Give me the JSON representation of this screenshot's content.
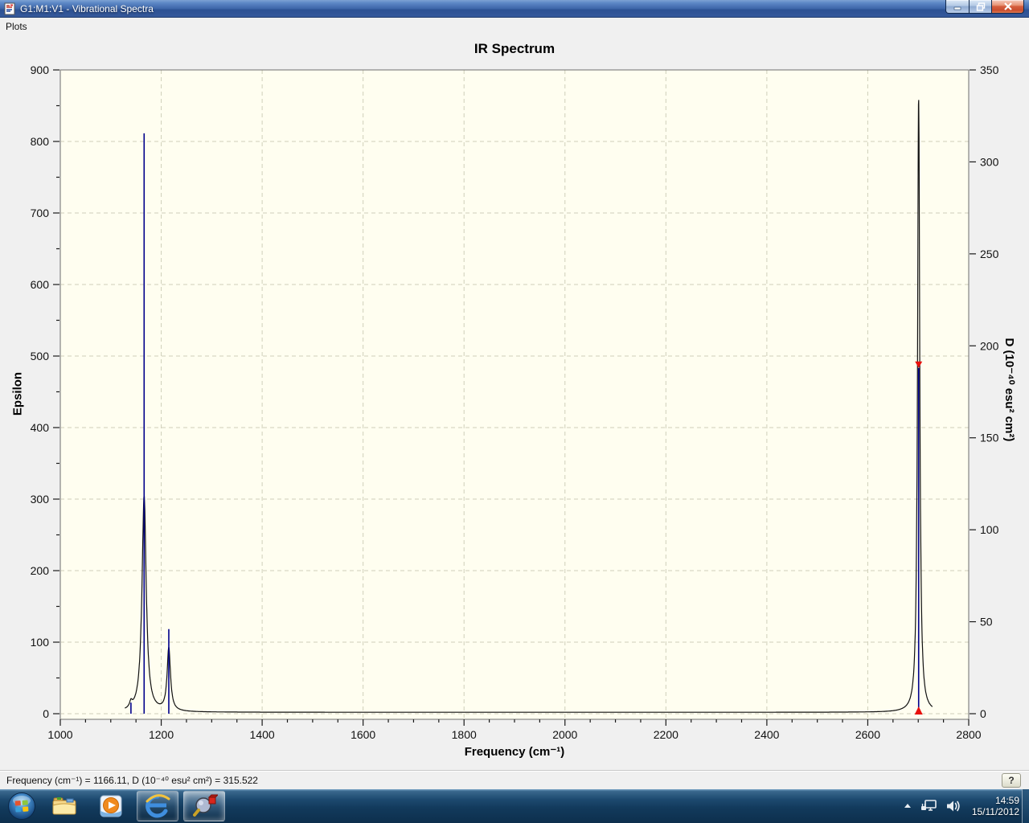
{
  "window": {
    "title": "G1:M1:V1 - Vibrational Spectra"
  },
  "menu_bar": {
    "items": [
      {
        "label": "Plots"
      }
    ]
  },
  "chart_data": {
    "type": "line",
    "title": "IR Spectrum",
    "xlabel": "Frequency (cm⁻¹)",
    "ylabel_left": "Epsilon",
    "ylabel_right": "D (10⁻⁴⁰ esu² cm²)",
    "x_range": [
      1000,
      2800
    ],
    "x_major_step": 200,
    "x_minor_step": 50,
    "y_left_range": [
      0,
      900
    ],
    "y_left_major_step": 100,
    "y_left_minor_step": 50,
    "y_right_range": [
      0,
      350
    ],
    "y_right_major_step": 50,
    "grid": "dashed",
    "legend": "none",
    "plot_bg": "#fffef0",
    "grid_color": "#cfcfba",
    "curve_color": "#111111",
    "stick_color": "#00008b",
    "marker_color": "#e8100c",
    "curve_domain": [
      1128,
      2728
    ],
    "baseline_epsilon": 2,
    "peaks": [
      {
        "freq": 1140.0,
        "epsilon": 10,
        "D": 6,
        "gamma": 3.0,
        "selected": false
      },
      {
        "freq": 1166.11,
        "epsilon": 305,
        "D": 315.522,
        "gamma": 5.0,
        "selected": false
      },
      {
        "freq": 1215.0,
        "epsilon": 90,
        "D": 46,
        "gamma": 4.0,
        "selected": false
      },
      {
        "freq": 2700.8,
        "epsilon": 863,
        "D": 188,
        "gamma": 2.6,
        "selected": true
      }
    ]
  },
  "status_bar": {
    "text": "Frequency (cm⁻¹) = 1166.11, D (10⁻⁴⁰ esu² cm²) = 315.522",
    "help_label": "?"
  },
  "taskbar": {
    "apps": [
      {
        "name": "windows-explorer",
        "active": false
      },
      {
        "name": "windows-media-player",
        "active": false
      },
      {
        "name": "internet-explorer",
        "active": true
      },
      {
        "name": "molecule-viewer",
        "active": true
      }
    ],
    "tray": {
      "time": "14:59",
      "date": "15/11/2012"
    }
  }
}
